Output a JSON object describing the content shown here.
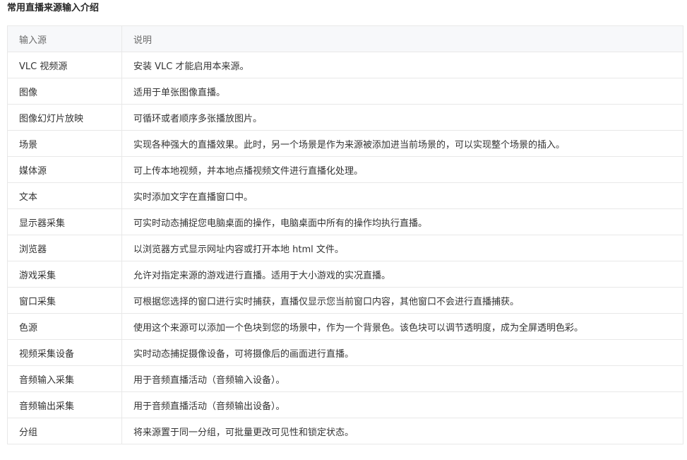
{
  "page": {
    "title": "常用直播来源输入介绍"
  },
  "table": {
    "headers": [
      "输入源",
      "说明"
    ],
    "rows": [
      {
        "source": "VLC 视频源",
        "description": "安装 VLC 才能启用本来源。"
      },
      {
        "source": "图像",
        "description": "适用于单张图像直播。"
      },
      {
        "source": "图像幻灯片放映",
        "description": "可循环或者顺序多张播放图片。"
      },
      {
        "source": "场景",
        "description": "实现各种强大的直播效果。此时，另一个场景是作为来源被添加进当前场景的，可以实现整个场景的插入。"
      },
      {
        "source": "媒体源",
        "description": "可上传本地视频，并本地点播视频文件进行直播化处理。"
      },
      {
        "source": "文本",
        "description": "实时添加文字在直播窗口中。"
      },
      {
        "source": "显示器采集",
        "description": "可实时动态捕捉您电脑桌面的操作，电脑桌面中所有的操作均执行直播。"
      },
      {
        "source": "浏览器",
        "description": "以浏览器方式显示网址内容或打开本地 html 文件。"
      },
      {
        "source": "游戏采集",
        "description": "允许对指定来源的游戏进行直播。适用于大小游戏的实况直播。"
      },
      {
        "source": "窗口采集",
        "description": "可根据您选择的窗口进行实时捕获，直播仅显示您当前窗口内容，其他窗口不会进行直播捕获。"
      },
      {
        "source": "色源",
        "description": "使用这个来源可以添加一个色块到您的场景中，作为一个背景色。该色块可以调节透明度，成为全屏透明色彩。"
      },
      {
        "source": "视频采集设备",
        "description": "实时动态捕捉摄像设备，可将摄像后的画面进行直播。"
      },
      {
        "source": "音频输入采集",
        "description": "用于音频直播活动（音频输入设备）。"
      },
      {
        "source": "音频输出采集",
        "description": "用于音频直播活动（音频输出设备）。"
      },
      {
        "source": "分组",
        "description": "将来源置于同一分组，可批量更改可见性和锁定状态。"
      }
    ]
  }
}
